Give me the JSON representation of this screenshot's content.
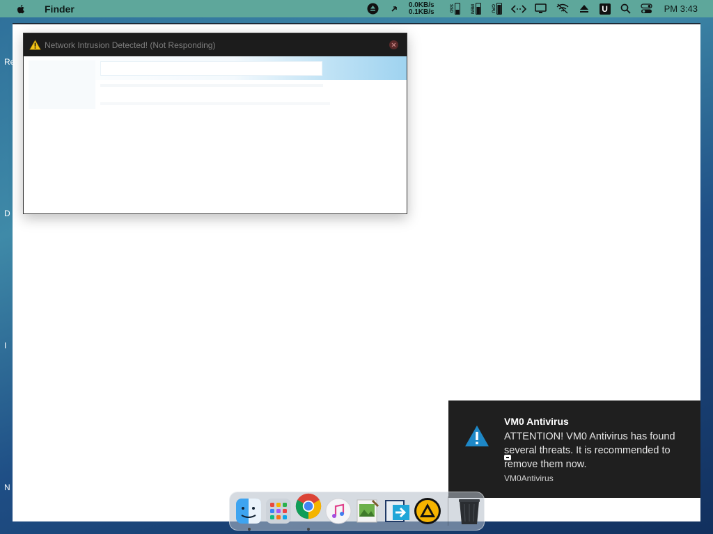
{
  "menubar": {
    "app_name": "Finder",
    "net_down": "0.0KB/s",
    "net_up": "0.1KB/s",
    "ssd_label": "SSD",
    "mem_label": "MEM",
    "cpu_label": "CPU",
    "u_label": "U",
    "clock": "PM 3:43"
  },
  "desktop_edge": {
    "items": [
      "Re",
      "D",
      "I",
      "N"
    ]
  },
  "window": {
    "title": "Network Intrusion Detected! (Not Responding)"
  },
  "notification": {
    "title": "VM0 Antivirus",
    "message": "ATTENTION! VM0 Antivirus has found several threats. It is recommended to remove them now.",
    "source": "VM0Antivirus",
    "accent": "#1e88c7"
  },
  "dock": {
    "items": [
      {
        "name": "Finder",
        "running": true
      },
      {
        "name": "Launchpad",
        "running": false
      },
      {
        "name": "Google Chrome",
        "running": true
      },
      {
        "name": "iTunes",
        "running": false
      },
      {
        "name": "Preview",
        "running": false
      },
      {
        "name": "Migration Assistant",
        "running": false
      },
      {
        "name": "AIMP",
        "running": false
      },
      {
        "name": "Trash",
        "running": false
      }
    ]
  }
}
